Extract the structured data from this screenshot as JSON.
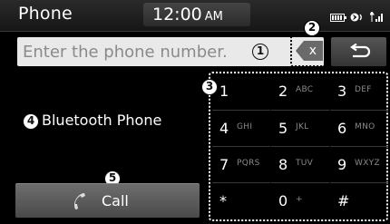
{
  "status_bar": {
    "title": "Phone",
    "time": "12:00",
    "ampm": "AM"
  },
  "input": {
    "placeholder": "Enter the phone number."
  },
  "clear_button": {
    "label": "x"
  },
  "left_panel": {
    "device_label": "Bluetooth Phone",
    "call_label": "Call"
  },
  "callouts": [
    "1",
    "2",
    "3",
    "4",
    "5"
  ],
  "keypad": {
    "keys": [
      {
        "digit": "1",
        "letters": ""
      },
      {
        "digit": "2",
        "letters": "ABC"
      },
      {
        "digit": "3",
        "letters": "DEF"
      },
      {
        "digit": "4",
        "letters": "GHI"
      },
      {
        "digit": "5",
        "letters": "JKL"
      },
      {
        "digit": "6",
        "letters": "MNO"
      },
      {
        "digit": "7",
        "letters": "PQRS"
      },
      {
        "digit": "8",
        "letters": "TUV"
      },
      {
        "digit": "9",
        "letters": "WXYZ"
      },
      {
        "digit": "*",
        "letters": ""
      },
      {
        "digit": "0",
        "letters": "+"
      },
      {
        "digit": "#",
        "letters": ""
      }
    ]
  }
}
